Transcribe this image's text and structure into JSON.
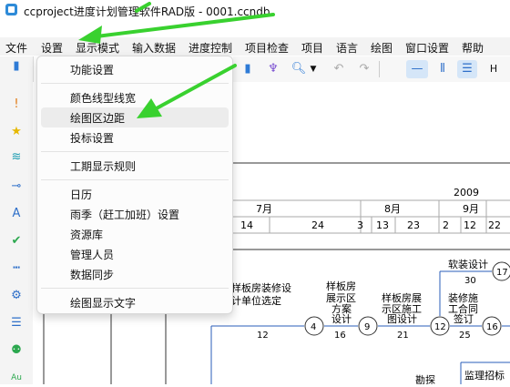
{
  "window": {
    "title": "ccproject进度计划管理软件RAD版 - 0001.ccndb"
  },
  "menubar": {
    "items": [
      "文件",
      "设置",
      "显示模式",
      "输入数据",
      "进度控制",
      "项目检查",
      "项目",
      "语言",
      "绘图",
      "窗口设置",
      "帮助"
    ]
  },
  "settings_menu": {
    "items": [
      "功能设置",
      "颜色线型线宽",
      "绘图区边距",
      "投标设置",
      "工期显示规则",
      "日历",
      "雨季（赶工加班）设置",
      "资源库",
      "管理人员",
      "数据同步",
      "绘图显示文字"
    ],
    "highlighted": "绘图区边距"
  },
  "toolbar": {
    "h_label": "H"
  },
  "left_toolbar": {
    "bottom_label": "Au"
  },
  "timeline": {
    "year": "2009",
    "months": [
      "7月",
      "8月",
      "9月"
    ],
    "days": [
      "14",
      "24",
      "3",
      "13",
      "23",
      "2",
      "12",
      "22"
    ]
  },
  "network": {
    "nodes": [
      "4",
      "9",
      "12",
      "16",
      "17"
    ],
    "tasks": [
      {
        "name_lines": [
          "样板房装修设",
          "计单位选定"
        ],
        "duration": "12"
      },
      {
        "name_lines": [
          "样板房",
          "展示区",
          "方案",
          "设计"
        ],
        "duration": "16"
      },
      {
        "name_lines": [
          "样板房展",
          "示区施工",
          "图设计"
        ],
        "duration": "21"
      },
      {
        "name_lines": [
          "装修施",
          "工合同",
          "签订"
        ],
        "duration": "25"
      },
      {
        "name_lines": [
          "软装设计"
        ],
        "duration": "30"
      },
      {
        "name_lines": [
          "勘探"
        ],
        "duration": ""
      },
      {
        "name_lines": [
          "监理招标"
        ],
        "duration": ""
      }
    ]
  }
}
